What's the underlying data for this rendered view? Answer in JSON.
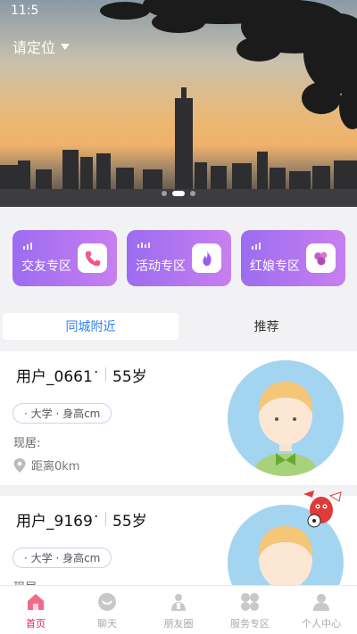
{
  "status_bar": {
    "time": "11:5"
  },
  "header": {
    "location_label": "请定位"
  },
  "carousel": {
    "slide_count": 3,
    "active_index": 1
  },
  "zones": [
    {
      "label": "交友专区",
      "icon": "phone-icon"
    },
    {
      "label": "活动专区",
      "icon": "flame-icon"
    },
    {
      "label": "红娘专区",
      "icon": "heart-cluster-icon"
    }
  ],
  "tabs": [
    {
      "label": "同城附近",
      "active": true
    },
    {
      "label": "推荐",
      "active": false
    }
  ],
  "users": [
    {
      "name": "用户_0661",
      "dot": "·",
      "age": "55岁",
      "tag": "· 大学 · 身高cm",
      "reside": "现居:",
      "distance": "距离0km"
    },
    {
      "name": "用户_9169",
      "dot": "·",
      "age": "55岁",
      "tag": "· 大学 · 身高cm",
      "reside": "现居:"
    }
  ],
  "bottom_nav": [
    {
      "label": "首页",
      "icon": "home-icon",
      "active": true
    },
    {
      "label": "聊天",
      "icon": "chat-icon",
      "active": false
    },
    {
      "label": "朋友圈",
      "icon": "friends-icon",
      "active": false
    },
    {
      "label": "服务专区",
      "icon": "grid-icon",
      "active": false
    },
    {
      "label": "个人中心",
      "icon": "person-icon",
      "active": false
    }
  ],
  "colors": {
    "accent": "#2f80ed",
    "zone_gradient_start": "#9c6cf0",
    "zone_gradient_end": "#c87ff0",
    "nav_active": "#e0245e"
  }
}
